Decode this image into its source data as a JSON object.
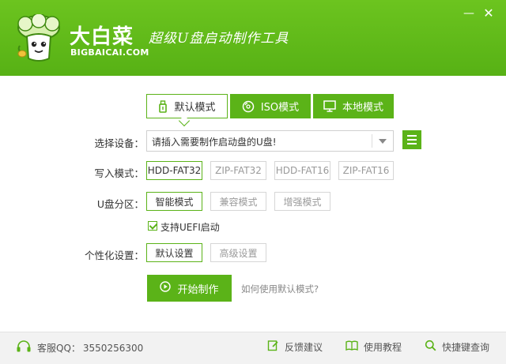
{
  "header": {
    "brand_cn": "大白菜",
    "brand_en": "BIGBAICAI.COM",
    "slogan": "超级U盘启动制作工具",
    "minimize_glyph": "—",
    "close_glyph": "✕"
  },
  "modes": [
    {
      "label": "默认模式",
      "icon": "usb-icon",
      "active": true
    },
    {
      "label": "ISO模式",
      "icon": "disc-icon",
      "active": false
    },
    {
      "label": "本地模式",
      "icon": "monitor-icon",
      "active": false
    }
  ],
  "device": {
    "label": "选择设备：",
    "value": "请插入需要制作启动盘的U盘!"
  },
  "write_mode": {
    "label": "写入模式：",
    "options": [
      "HDD-FAT32",
      "ZIP-FAT32",
      "HDD-FAT16",
      "ZIP-FAT16"
    ],
    "selected": "HDD-FAT32"
  },
  "partition": {
    "label": "U盘分区：",
    "options": [
      "智能模式",
      "兼容模式",
      "增强模式"
    ],
    "selected": "智能模式"
  },
  "uefi": {
    "label": "支持UEFI启动",
    "checked": true
  },
  "personalize": {
    "label": "个性化设置：",
    "options": [
      "默认设置",
      "高级设置"
    ],
    "selected": "默认设置"
  },
  "actions": {
    "start_label": "开始制作",
    "help_link": "如何使用默认模式?"
  },
  "footer": {
    "support_label": "客服QQ：",
    "support_qq": "3550256300",
    "feedback": "反馈建议",
    "tutorial": "使用教程",
    "shortcut": "快捷键查询"
  },
  "colors": {
    "accent": "#5bb318",
    "header_top": "#6cc41f",
    "footer_bg": "#f2f2f2"
  }
}
